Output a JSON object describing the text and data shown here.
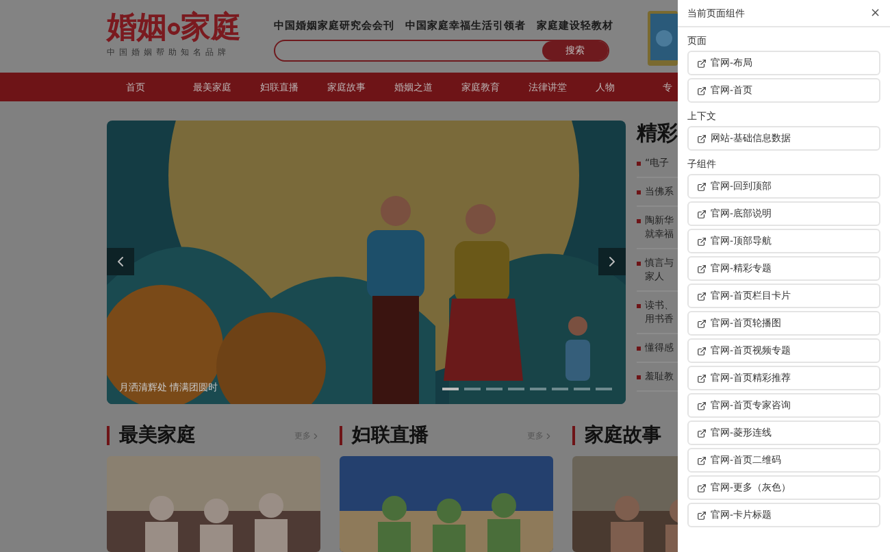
{
  "header": {
    "logo": {
      "first": "婚姻",
      "second": "家庭",
      "tagline": "中国婚姻帮助知名品牌"
    },
    "slogans": [
      "中国婚姻家庭研究会会刊",
      "中国家庭幸福生活引领者",
      "家庭建设轻教材"
    ],
    "search": {
      "button": "搜索"
    }
  },
  "nav": [
    "首页",
    "最美家庭",
    "妇联直播",
    "家庭故事",
    "婚姻之道",
    "家庭教育",
    "法律讲堂",
    "人物",
    "专"
  ],
  "carousel": {
    "kind": "picture",
    "caption": "月洒清辉处 情满团圆时",
    "indicators": [
      {
        "selected": true
      },
      {
        "selected": false
      },
      {
        "selected": false
      },
      {
        "selected": false
      },
      {
        "selected": false
      },
      {
        "selected": false
      },
      {
        "selected": false
      },
      {
        "selected": false
      }
    ]
  },
  "featured": {
    "title": "精彩",
    "items": [
      "“电子",
      "当佛系",
      "陶新华就幸福",
      "慎言与家人",
      "读书、用书香",
      "懂得感",
      "羞耻教"
    ]
  },
  "sections": [
    {
      "title": "最美家庭",
      "more": "更多"
    },
    {
      "title": "妇联直播",
      "more": "更多"
    },
    {
      "title": "家庭故事"
    }
  ],
  "panel": {
    "title": "当前页面组件",
    "close": "×",
    "groups": [
      {
        "label": "页面",
        "items": [
          "官网-布局",
          "官网-首页"
        ]
      },
      {
        "label": "上下文",
        "items": [
          "网站-基础信息数据"
        ]
      },
      {
        "label": "子组件",
        "items": [
          "官网-回到顶部",
          "官网-底部说明",
          "官网-顶部导航",
          "官网-精彩专题",
          "官网-首页栏目卡片",
          "官网-首页轮播图",
          "官网-首页视频专题",
          "官网-首页精彩推荐",
          "官网-首页专家咨询",
          "官网-菱形连线",
          "官网-首页二维码",
          "官网-更多（灰色）",
          "官网-卡片标题"
        ]
      }
    ]
  }
}
